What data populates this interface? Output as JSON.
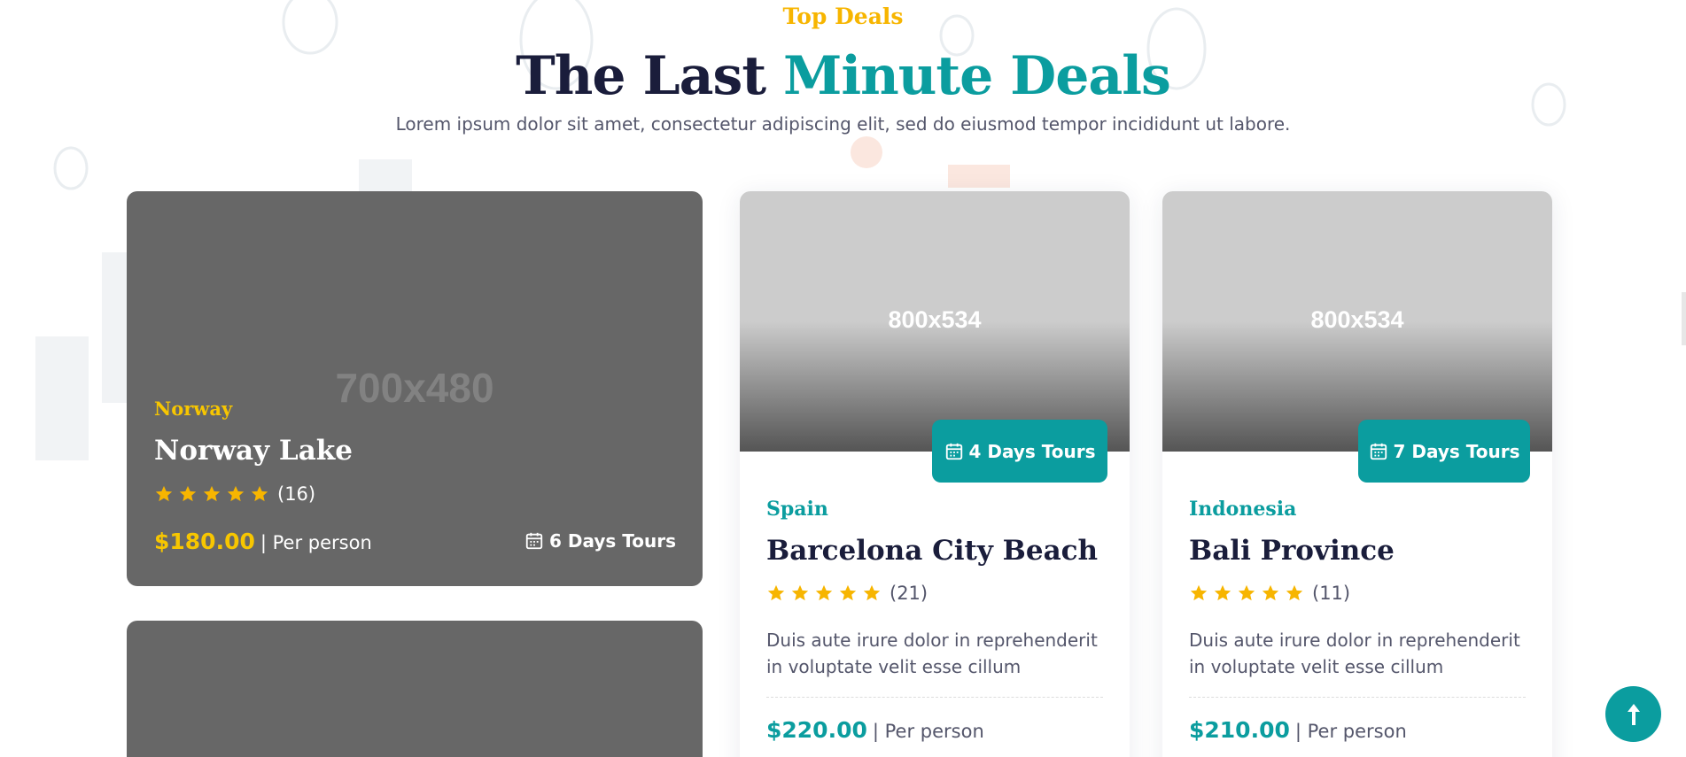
{
  "header": {
    "eyebrow": "Top Deals",
    "title_main": "The Last",
    "title_accent": "Minute Deals",
    "subtitle": "Lorem ipsum dolor sit amet, consectetur adipiscing elit, sed do eiusmod tempor incididunt ut labore."
  },
  "featured_card": {
    "image_placeholder": "700x480",
    "country": "Norway",
    "name": "Norway Lake",
    "stars": 5,
    "review_count": "(16)",
    "price": "$180.00",
    "price_unit": "| Per person",
    "duration": "6 Days Tours",
    "duration_icon": "calendar-icon"
  },
  "cards": [
    {
      "image_placeholder": "800x534",
      "duration": "4 Days Tours",
      "country": "Spain",
      "name": "Barcelona City Beach",
      "stars": 5,
      "review_count": "(21)",
      "description": "Duis aute irure dolor in reprehenderit in voluptate velit esse cillum",
      "price": "$220.00",
      "price_unit": "| Per person"
    },
    {
      "image_placeholder": "800x534",
      "duration": "7 Days Tours",
      "country": "Indonesia",
      "name": "Bali Province",
      "stars": 5,
      "review_count": "(11)",
      "description": "Duis aute irure dolor in reprehenderit in voluptate velit esse cillum",
      "price": "$210.00",
      "price_unit": "| Per person"
    }
  ],
  "scroll_top": {
    "icon": "arrow-up-icon"
  },
  "colors": {
    "accent": "#0b9d9f",
    "gold": "#f7b500",
    "navy": "#1a1d3b",
    "star": "#f7b500"
  }
}
